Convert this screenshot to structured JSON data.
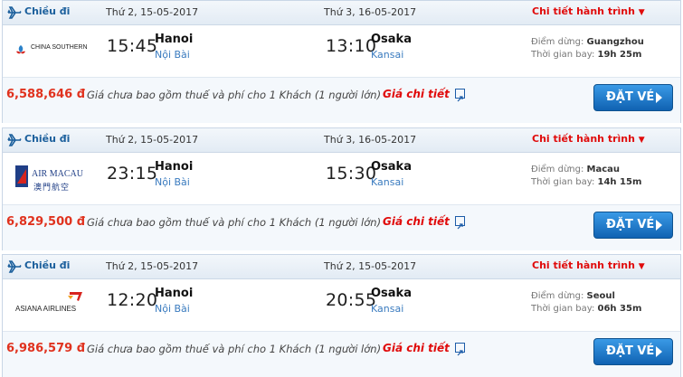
{
  "flights": [
    {
      "direction": "Chiều đi",
      "depart_date": "Thứ 2, 15-05-2017",
      "arrive_date": "Thứ 3, 16-05-2017",
      "detail_link": "Chi tiết hành trình",
      "airline": "CHINA SOUTHERN",
      "dep_time": "15:45",
      "dep_city": "Hanoi",
      "dep_airport": "Nội Bài",
      "arr_time": "13:10",
      "arr_city": "Osaka",
      "arr_airport": "Kansai",
      "stop_label": "Điểm dừng:",
      "stop": "Guangzhou",
      "duration_label": "Thời gian bay:",
      "duration": "19h 25m",
      "price": "6,588,646 đ",
      "price_note": "Giá chưa bao gồm thuế và phí cho 1 Khách (1 người lớn)",
      "price_detail": "Giá chi tiết",
      "book": "ĐẶT VÉ"
    },
    {
      "direction": "Chiều đi",
      "depart_date": "Thứ 2, 15-05-2017",
      "arrive_date": "Thứ 3, 16-05-2017",
      "detail_link": "Chi tiết hành trình",
      "airline": "AIR MACAU",
      "airline_sub": "澳門航空",
      "dep_time": "23:15",
      "dep_city": "Hanoi",
      "dep_airport": "Nội Bài",
      "arr_time": "15:30",
      "arr_city": "Osaka",
      "arr_airport": "Kansai",
      "stop_label": "Điểm dừng:",
      "stop": "Macau",
      "duration_label": "Thời gian bay:",
      "duration": "14h 15m",
      "price": "6,829,500 đ",
      "price_note": "Giá chưa bao gồm thuế và phí cho 1 Khách (1 người lớn)",
      "price_detail": "Giá chi tiết",
      "book": "ĐẶT VÉ"
    },
    {
      "direction": "Chiều đi",
      "depart_date": "Thứ 2, 15-05-2017",
      "arrive_date": "Thứ 2, 15-05-2017",
      "detail_link": "Chi tiết hành trình",
      "airline": "ASIANA AIRLINES",
      "dep_time": "12:20",
      "dep_city": "Hanoi",
      "dep_airport": "Nội Bài",
      "arr_time": "20:55",
      "arr_city": "Osaka",
      "arr_airport": "Kansai",
      "stop_label": "Điểm dừng:",
      "stop": "Seoul",
      "duration_label": "Thời gian bay:",
      "duration": "06h 35m",
      "price": "6,986,579 đ",
      "price_note": "Giá chưa bao gồm thuế và phí cho 1 Khách (1 người lớn)",
      "price_detail": "Giá chi tiết",
      "book": "ĐẶT VÉ"
    }
  ],
  "colors": {
    "price": "#e0321e",
    "link_red": "#e00b0b",
    "airport_blue": "#3a7bbf",
    "button": "#1c74c8"
  }
}
